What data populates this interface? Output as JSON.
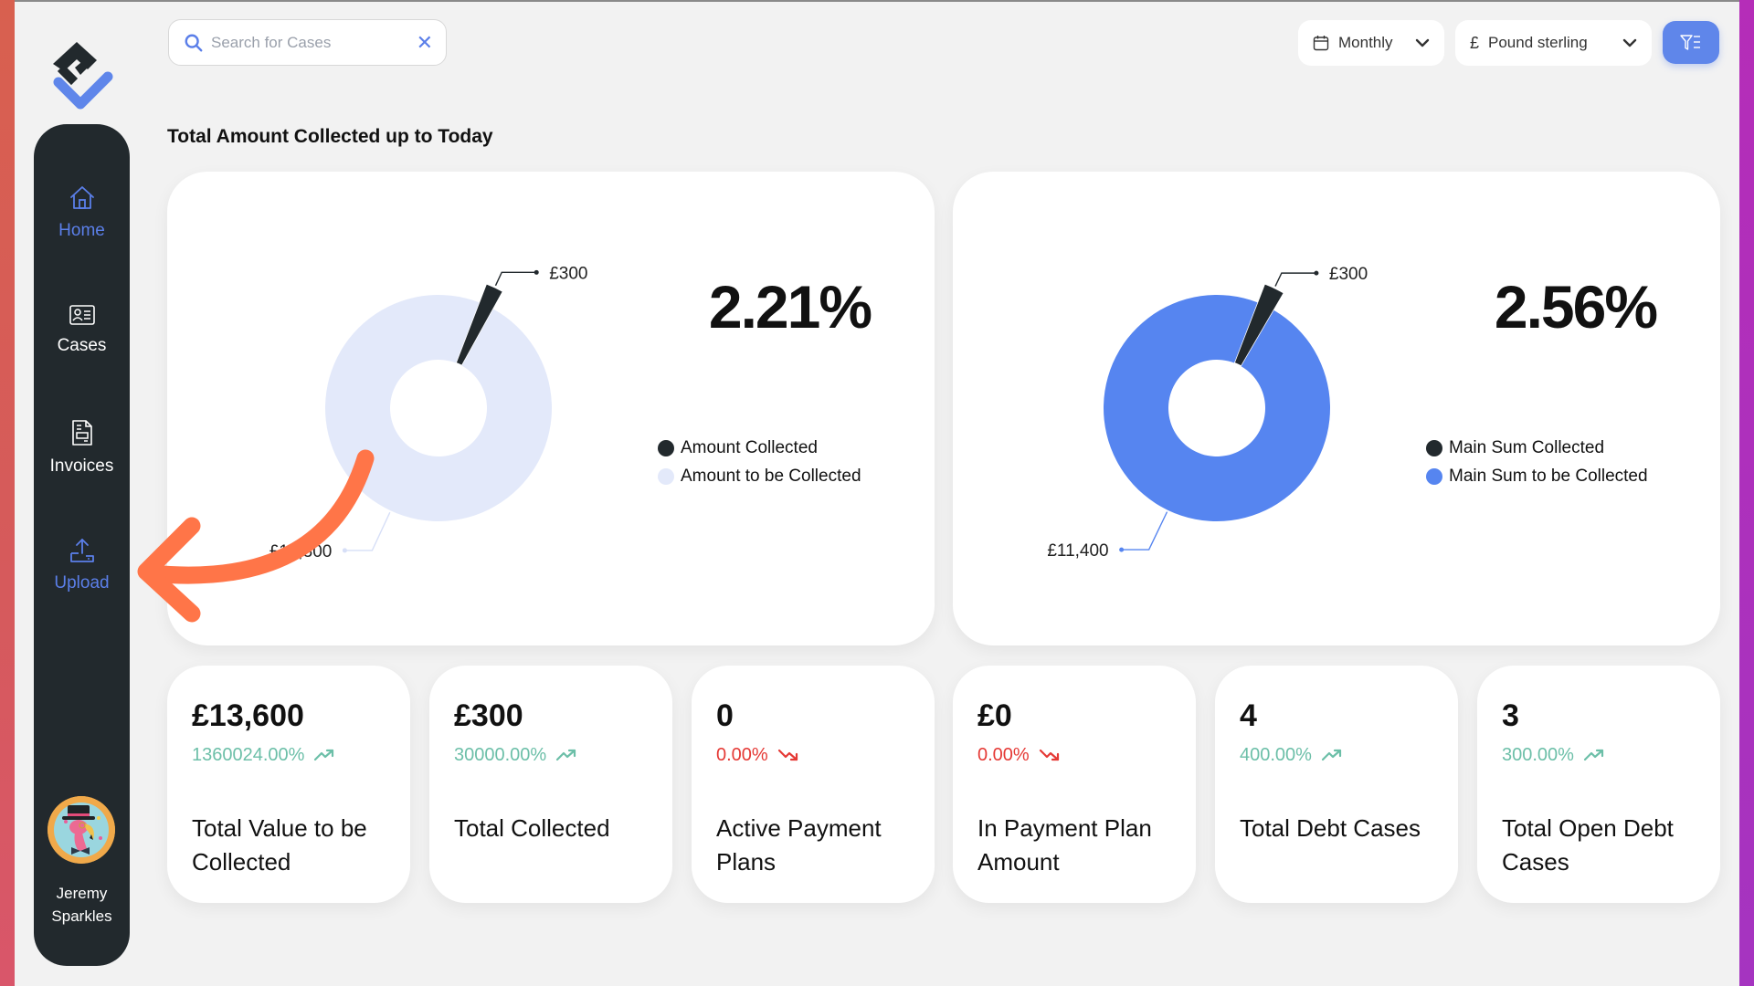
{
  "search": {
    "placeholder": "Search for Cases",
    "value": "",
    "clear_icon": "close-icon"
  },
  "filters": {
    "period": {
      "icon": "calendar-icon",
      "selected": "Monthly"
    },
    "currency": {
      "icon": "pound-sign",
      "symbol": "£",
      "selected": "Pound sterling"
    },
    "filter_button_icon": "filter-list-icon"
  },
  "sidebar": {
    "items": [
      {
        "label": "Home",
        "icon": "home-icon",
        "active": true
      },
      {
        "label": "Cases",
        "icon": "id-card-icon",
        "active": false
      },
      {
        "label": "Invoices",
        "icon": "invoice-icon",
        "active": false
      },
      {
        "label": "Upload",
        "icon": "upload-icon",
        "active": true
      }
    ],
    "user": {
      "first_name": "Jeremy",
      "last_name": "Sparkles"
    }
  },
  "section_title": "Total Amount Collected up to Today",
  "colors": {
    "accent": "#5b7fe9",
    "dark": "#22292d",
    "donut_light": "#e3e9fa",
    "donut_blue": "#5685f0",
    "positive": "#6cbfa8",
    "negative": "#e53935",
    "annotation": "#ff7548"
  },
  "chart_data": [
    {
      "type": "pie",
      "variant": "donut",
      "title": "",
      "percent_label": "2.21%",
      "series": [
        {
          "name": "Amount Collected",
          "value": 300,
          "label": "£300",
          "color": "#22292d"
        },
        {
          "name": "Amount to be Collected",
          "value": 13300,
          "label": "£13,300",
          "color": "#e3e9fa"
        }
      ],
      "legend_position": "right"
    },
    {
      "type": "pie",
      "variant": "donut",
      "title": "",
      "percent_label": "2.56%",
      "series": [
        {
          "name": "Main Sum Collected",
          "value": 300,
          "label": "£300",
          "color": "#22292d"
        },
        {
          "name": "Main Sum to be Collected",
          "value": 11400,
          "label": "£11,400",
          "color": "#5685f0"
        }
      ],
      "legend_position": "right"
    }
  ],
  "stats": [
    {
      "value": "£13,600",
      "change": "1360024.00%",
      "trend": "up",
      "label": "Total Value to be Collected"
    },
    {
      "value": "£300",
      "change": "30000.00%",
      "trend": "up",
      "label": "Total Collected"
    },
    {
      "value": "0",
      "change": "0.00%",
      "trend": "down",
      "label": "Active Payment Plans"
    },
    {
      "value": "£0",
      "change": "0.00%",
      "trend": "down",
      "label": "In Payment Plan Amount"
    },
    {
      "value": "4",
      "change": "400.00%",
      "trend": "up",
      "label": "Total Debt Cases"
    },
    {
      "value": "3",
      "change": "300.00%",
      "trend": "up",
      "label": "Total Open Debt Cases"
    }
  ],
  "annotation": {
    "type": "curved-arrow",
    "points_to": "Upload"
  }
}
